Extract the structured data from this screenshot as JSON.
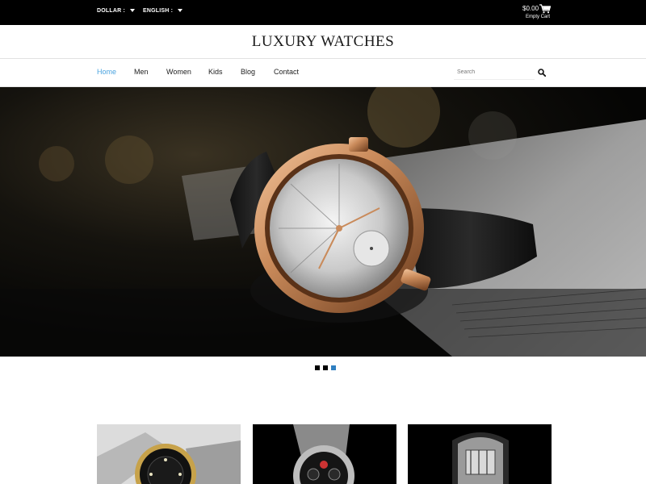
{
  "topbar": {
    "currency_label": "DOLLAR :",
    "language_label": "ENGLISH :",
    "cart_total": "$0.00",
    "cart_status": "Empty Cart"
  },
  "brand": {
    "title": "LUXURY WATCHES"
  },
  "nav": {
    "items": [
      {
        "label": "Home",
        "active": true
      },
      {
        "label": "Men"
      },
      {
        "label": "Women"
      },
      {
        "label": "Kids"
      },
      {
        "label": "Blog"
      },
      {
        "label": "Contact"
      }
    ]
  },
  "search": {
    "placeholder": "Search"
  },
  "slider": {
    "slide_count": 3,
    "active_index": 2
  },
  "icons": {
    "cart": "shopping-cart-icon",
    "search": "magnifier-icon",
    "dropdown": "caret-down-icon"
  },
  "colors": {
    "topbar_bg": "#000000",
    "nav_active": "#4aa3df",
    "slider_active_dot": "#2f7fc1"
  }
}
